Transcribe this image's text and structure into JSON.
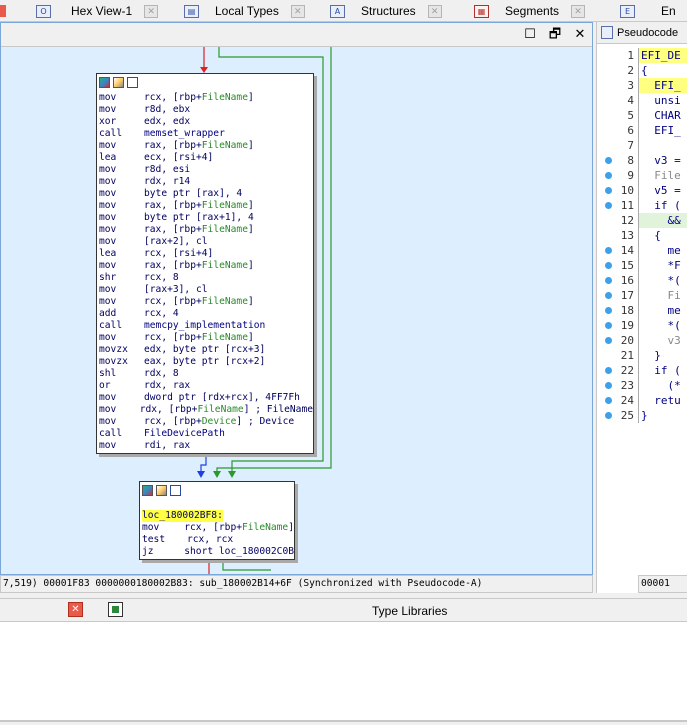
{
  "tabs": [
    {
      "label": "Hex View-1",
      "icon": "hex-view-icon"
    },
    {
      "label": "Local Types",
      "icon": "local-types-icon"
    },
    {
      "label": "Structures",
      "icon": "structures-icon"
    },
    {
      "label": "Segments",
      "icon": "segments-icon"
    },
    {
      "label": "En",
      "icon": "enums-icon"
    }
  ],
  "graph": {
    "window_buttons": {
      "restore": "☐",
      "float": "🗗",
      "close": "✕"
    },
    "node1": [
      [
        "mov",
        "rcx, [rbp+",
        "FileName",
        "]"
      ],
      [
        "mov",
        "r8d, ebx",
        "",
        ""
      ],
      [
        "xor",
        "edx, edx",
        "",
        ""
      ],
      [
        "call",
        "",
        "memset_wrapper",
        ""
      ],
      [
        "mov",
        "rax, [rbp+",
        "FileName",
        "]"
      ],
      [
        "lea",
        "ecx, [rsi+4]",
        "",
        ""
      ],
      [
        "mov",
        "r8d, esi",
        "",
        ""
      ],
      [
        "mov",
        "rdx, r14",
        "",
        ""
      ],
      [
        "mov",
        "byte ptr [rax], 4",
        "",
        ""
      ],
      [
        "mov",
        "rax, [rbp+",
        "FileName",
        "]"
      ],
      [
        "mov",
        "byte ptr [rax+1], 4",
        "",
        ""
      ],
      [
        "mov",
        "rax, [rbp+",
        "FileName",
        "]"
      ],
      [
        "mov",
        "[rax+2], cl",
        "",
        ""
      ],
      [
        "lea",
        "rcx, [rsi+4]",
        "",
        ""
      ],
      [
        "mov",
        "rax, [rbp+",
        "FileName",
        "]"
      ],
      [
        "shr",
        "rcx, 8",
        "",
        ""
      ],
      [
        "mov",
        "[rax+3], cl",
        "",
        ""
      ],
      [
        "mov",
        "rcx, [rbp+",
        "FileName",
        "]"
      ],
      [
        "add",
        "rcx, 4",
        "",
        ""
      ],
      [
        "call",
        "",
        "memcpy_implementation",
        ""
      ],
      [
        "mov",
        "rcx, [rbp+",
        "FileName",
        "]"
      ],
      [
        "movzx",
        "edx, byte ptr [rcx+3]",
        "",
        ""
      ],
      [
        "movzx",
        "eax, byte ptr [rcx+2]",
        "",
        ""
      ],
      [
        "shl",
        "rdx, 8",
        "",
        ""
      ],
      [
        "or",
        "rdx, rax",
        "",
        ""
      ],
      [
        "mov",
        "dword ptr [rdx+rcx], 4FF7Fh",
        "",
        ""
      ],
      [
        "mov",
        "rdx, [rbp+",
        "FileName",
        "] ; FileName"
      ],
      [
        "mov",
        "rcx, [rbp+",
        "Device",
        "] ; Device"
      ],
      [
        "call",
        "",
        "FileDevicePath",
        ""
      ],
      [
        "mov",
        "rdi, rax",
        "",
        ""
      ]
    ],
    "node2_label": "loc_180002BF8:",
    "node2": [
      [
        "mov",
        "rcx, [rbp+",
        "FileName",
        "]"
      ],
      [
        "test",
        "rcx, rcx",
        "",
        ""
      ],
      [
        "jz",
        "short loc_180002C0B",
        "",
        ""
      ]
    ]
  },
  "status": "7,519) 00001F83 0000000180002B83: sub_180002B14+6F (Synchronized with Pseudocode-A)",
  "pseudocode": {
    "tab_label": "Pseudocode",
    "lines": [
      {
        "n": "1",
        "text": "EFI_DE",
        "dot": false,
        "style": "yl"
      },
      {
        "n": "2",
        "text": "{",
        "dot": false,
        "style": ""
      },
      {
        "n": "3",
        "text": "  EFI_",
        "dot": false,
        "style": "yl"
      },
      {
        "n": "4",
        "text": "  unsi",
        "dot": false,
        "style": ""
      },
      {
        "n": "5",
        "text": "  CHAR",
        "dot": false,
        "style": ""
      },
      {
        "n": "6",
        "text": "  EFI_",
        "dot": false,
        "style": ""
      },
      {
        "n": "7",
        "text": "",
        "dot": false,
        "style": ""
      },
      {
        "n": "8",
        "text": "  v3 =",
        "dot": true,
        "style": ""
      },
      {
        "n": "9",
        "text": "  File",
        "dot": true,
        "style": "gray"
      },
      {
        "n": "10",
        "text": "  v5 =",
        "dot": true,
        "style": ""
      },
      {
        "n": "11",
        "text": "  if (",
        "dot": true,
        "style": ""
      },
      {
        "n": "12",
        "text": "    &&",
        "dot": false,
        "style": "gr"
      },
      {
        "n": "13",
        "text": "  {",
        "dot": false,
        "style": ""
      },
      {
        "n": "14",
        "text": "    me",
        "dot": true,
        "style": ""
      },
      {
        "n": "15",
        "text": "    *F",
        "dot": true,
        "style": ""
      },
      {
        "n": "16",
        "text": "    *(",
        "dot": true,
        "style": ""
      },
      {
        "n": "17",
        "text": "    Fi",
        "dot": true,
        "style": "gray"
      },
      {
        "n": "18",
        "text": "    me",
        "dot": true,
        "style": ""
      },
      {
        "n": "19",
        "text": "    *(",
        "dot": true,
        "style": ""
      },
      {
        "n": "20",
        "text": "    v3",
        "dot": true,
        "style": "gray"
      },
      {
        "n": "21",
        "text": "  }",
        "dot": false,
        "style": ""
      },
      {
        "n": "22",
        "text": "  if (",
        "dot": true,
        "style": ""
      },
      {
        "n": "23",
        "text": "    (*",
        "dot": true,
        "style": ""
      },
      {
        "n": "24",
        "text": "  retu",
        "dot": true,
        "style": ""
      },
      {
        "n": "25",
        "text": "}",
        "dot": true,
        "style": ""
      }
    ],
    "status": "00001"
  },
  "bottom": {
    "type_libraries_label": "Type Libraries"
  }
}
